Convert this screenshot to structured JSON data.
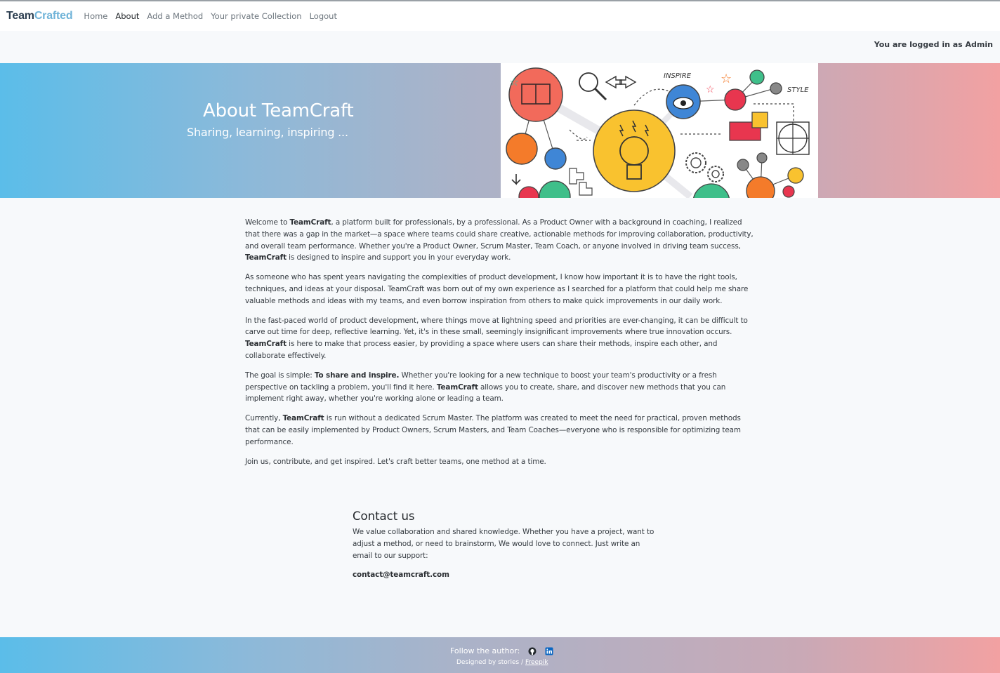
{
  "brand": {
    "part1": "Team",
    "part2": "Crafted"
  },
  "nav": {
    "items": [
      {
        "label": "Home"
      },
      {
        "label": "About",
        "active": true
      },
      {
        "label": "Add a Method"
      },
      {
        "label": "Your private Collection"
      },
      {
        "label": "Logout"
      }
    ]
  },
  "login_status": "You are logged in as Admin",
  "hero": {
    "title": "About TeamCraft",
    "subtitle": "Sharing, learning, inspiring ...",
    "illustration_labels": {
      "inspire": "INSPIRE",
      "style": "STYLE"
    }
  },
  "content": {
    "p1": {
      "a": "Welcome to ",
      "b": "TeamCraft",
      "c": ", a platform built for professionals, by a professional. As a Product Owner with a background in coaching, I realized that there was a gap in the market—a space where teams could share creative, actionable methods for improving collaboration, productivity, and overall team performance. Whether you're a Product Owner, Scrum Master, Team Coach, or anyone involved in driving team success, ",
      "d": "TeamCraft",
      "e": " is designed to inspire and support you in your everyday work."
    },
    "p2": "As someone who has spent years navigating the complexities of product development, I know how important it is to have the right tools, techniques, and ideas at your disposal. TeamCraft was born out of my own experience as I searched for a platform that could help me share valuable methods and ideas with my teams, and even borrow inspiration from others to make quick improvements in our daily work.",
    "p3": {
      "a": "In the fast-paced world of product development, where things move at lightning speed and priorities are ever-changing, it can be difficult to carve out time for deep, reflective learning. Yet, it's in these small, seemingly insignificant improvements where true innovation occurs. ",
      "b": "TeamCraft",
      "c": " is here to make that process easier, by providing a space where users can share their methods, inspire each other, and collaborate effectively."
    },
    "p4": {
      "a": "The goal is simple: ",
      "b": "To share and inspire.",
      "c": " Whether you're looking for a new technique to boost your team's productivity or a fresh perspective on tackling a problem, you'll find it here. ",
      "d": "TeamCraft",
      "e": " allows you to create, share, and discover new methods that you can implement right away, whether you're working alone or leading a team."
    },
    "p5": {
      "a": "Currently, ",
      "b": "TeamCraft",
      "c": " is run without a dedicated Scrum Master. The platform was created to meet the need for practical, proven methods that can be easily implemented by Product Owners, Scrum Masters, and Team Coaches—everyone who is responsible for optimizing team performance."
    },
    "p6": "Join us, contribute, and get inspired. Let's craft better teams, one method at a time."
  },
  "contact": {
    "title": "Contact us",
    "text": "We value collaboration and shared knowledge. Whether you have a project, want to adjust a method, or need to brainstorm, We would love to connect. Just write an email to our support:",
    "email": "contact@teamcraft.com"
  },
  "footer": {
    "follow_label": "Follow the author:",
    "icons": [
      "github-icon",
      "linkedin-icon"
    ],
    "designed_prefix": "Designed by stories / ",
    "designed_link": "Freepik"
  },
  "colors": {
    "brand_dark": "#2c3e50",
    "brand_light": "#6fb3d8",
    "gradient_start": "#5bbde9",
    "gradient_end": "#f2a1a2",
    "page_bg": "#f7f9fb"
  }
}
